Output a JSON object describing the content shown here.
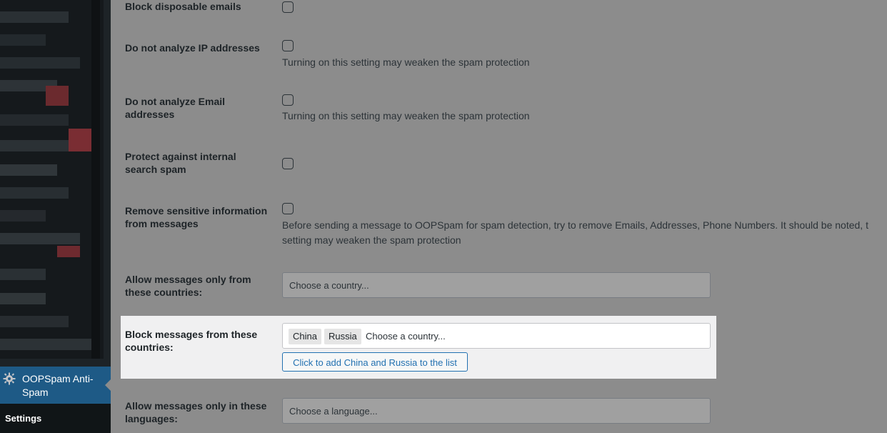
{
  "sidebar": {
    "active_menu": {
      "icon": "oopspam-gear-icon",
      "label": "OOPSpam Anti-Spam"
    },
    "submenu": {
      "label": "Settings"
    }
  },
  "settings": {
    "block_disposable": {
      "label": "Block disposable emails",
      "checked": false
    },
    "no_ip": {
      "label": "Do not analyze IP addresses",
      "checked": false,
      "description": "Turning on this setting may weaken the spam protection"
    },
    "no_email": {
      "label": "Do not analyze Email addresses",
      "checked": false,
      "description": "Turning on this setting may weaken the spam protection"
    },
    "internal_search": {
      "label": "Protect against internal search spam",
      "checked": false
    },
    "remove_sensitive": {
      "label": "Remove sensitive information from messages",
      "checked": false,
      "description": "Before sending a message to OOPSpam for spam detection, try to remove Emails, Addresses, Phone Numbers. It should be noted, t",
      "description_cont": "setting may weaken the spam protection"
    },
    "allow_countries": {
      "label": "Allow messages only from these countries:",
      "placeholder": "Choose a country..."
    },
    "block_countries": {
      "label": "Block messages from these countries:",
      "chips": [
        "China",
        "Russia"
      ],
      "placeholder": "Choose a country...",
      "button_label": "Click to add China and Russia to the list"
    },
    "allow_languages": {
      "label": "Allow messages only in these languages:",
      "placeholder": "Choose a language..."
    }
  },
  "colors": {
    "page_dim_bg": "#8c8c8c",
    "sidebar_bg": "#1d2327",
    "active_menu_bg": "#1e5a86",
    "highlight_bg": "#f0f0f1",
    "button_accent": "#2271b1"
  }
}
